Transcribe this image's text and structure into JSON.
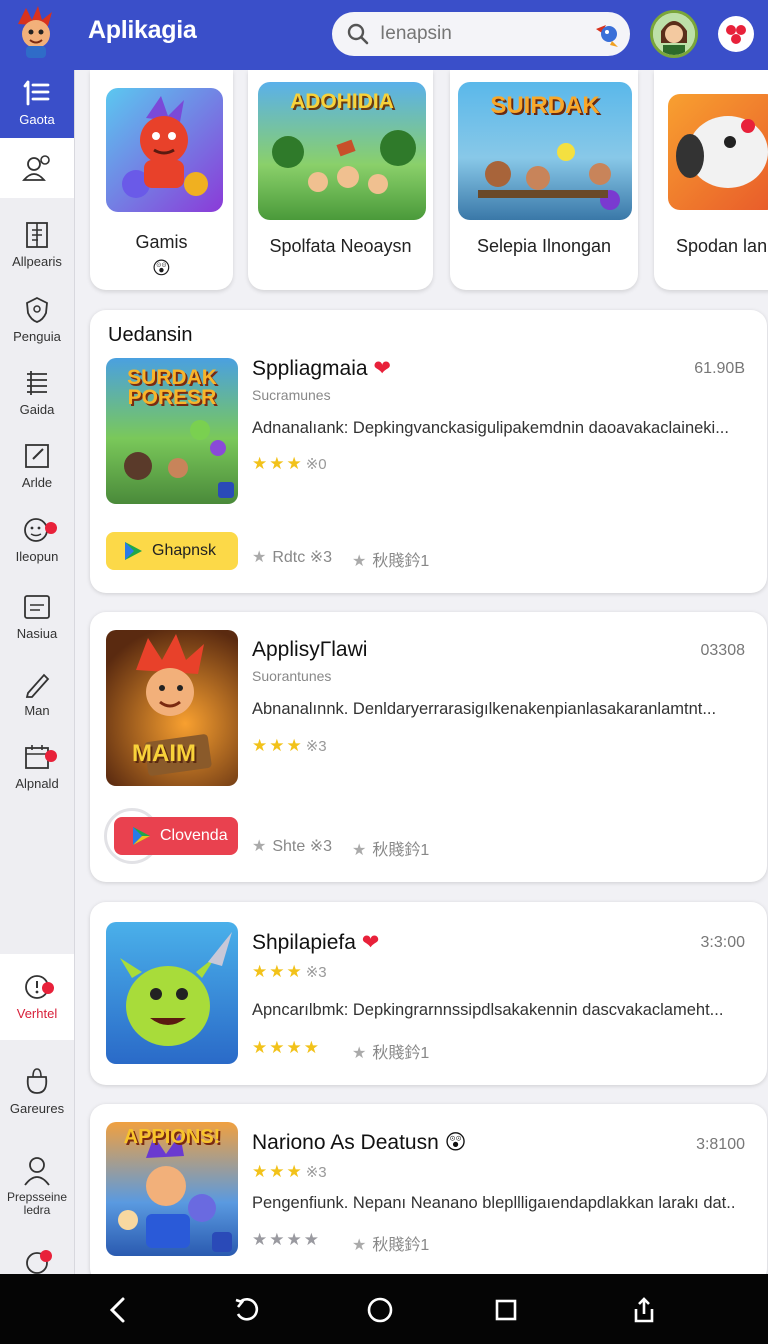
{
  "header": {
    "title": "Aplikagia",
    "search_placeholder": "Ienapsin"
  },
  "sidebar": {
    "items": [
      {
        "label": "Gaota",
        "icon": "list-icon"
      },
      {
        "label": "",
        "icon": "users-icon"
      },
      {
        "label": "Allpearis",
        "icon": "document-icon"
      },
      {
        "label": "Penguia",
        "icon": "shield-icon"
      },
      {
        "label": "Gaida",
        "icon": "list-lines-icon"
      },
      {
        "label": "Arlde",
        "icon": "edit-box-icon"
      },
      {
        "label": "Ileopun",
        "icon": "smile-icon"
      },
      {
        "label": "Nasiua",
        "icon": "message-icon"
      },
      {
        "label": "Man",
        "icon": "pencil-icon"
      },
      {
        "label": "Alpnald",
        "icon": "calendar-icon"
      },
      {
        "label": "Verhtel",
        "icon": "alert-icon"
      },
      {
        "label": "Gareures",
        "icon": "bag-icon"
      },
      {
        "label": "Prepsseine ledra",
        "icon": "person-icon"
      }
    ]
  },
  "featured": [
    {
      "name": "Gamis",
      "art_title": ""
    },
    {
      "name": "Spolfata Neoaysn",
      "art_title": "ADOHIDIA"
    },
    {
      "name": "Selepia Ilnongan",
      "art_title": "SUIRDAK"
    },
    {
      "name": "Spodan lan",
      "art_title": ""
    }
  ],
  "section_title": "Uedansin",
  "apps": [
    {
      "name": "Sppliagmaia",
      "size": "61.90B",
      "subtitle": "Sucramunes",
      "description": "Adnanalıank: Depkingvanckasigulipakemdnin daoavakaclaineki...",
      "rating_count": "※0",
      "art_title": "SURDAK PORESR",
      "button": "Ghapnsk",
      "grey_rating": "Rdtc ※3",
      "grey_count": "秋賤鈐1"
    },
    {
      "name": "ApplisyΓlawi",
      "size": "03308",
      "subtitle": "Suorantunes",
      "description": "Abnanalınnk. Denldaryerrarasigılkenakenpianlasakaranlamtnt...",
      "rating_count": "※3",
      "art_title": "MAIM",
      "button": "Clovenda",
      "grey_rating": "Shte ※3",
      "grey_count": "秋賤鈐1"
    },
    {
      "name": "Shpilapiefa",
      "size": "3:3:00",
      "description": "Apncarılbmk: Depkingrarnnssipdlsakakennin dascvakaclameht...",
      "rating_count": "※3",
      "grey_count": "秋賤鈐1"
    },
    {
      "name": "Nariono As Deatusn",
      "size": "3:8100",
      "description": "Pengenfiunk. Nepanı Neanano blepllligaıendapdlakkan larakı dat..",
      "rating_count": "※3",
      "art_title": "APPIONS!",
      "grey_count": "秋賤鈐1"
    }
  ],
  "colors": {
    "brand": "#3a4fc9",
    "star": "#f2c21a",
    "yellow_button": "#fcd948",
    "red_button": "#e9414f",
    "badge": "#e8213a"
  }
}
